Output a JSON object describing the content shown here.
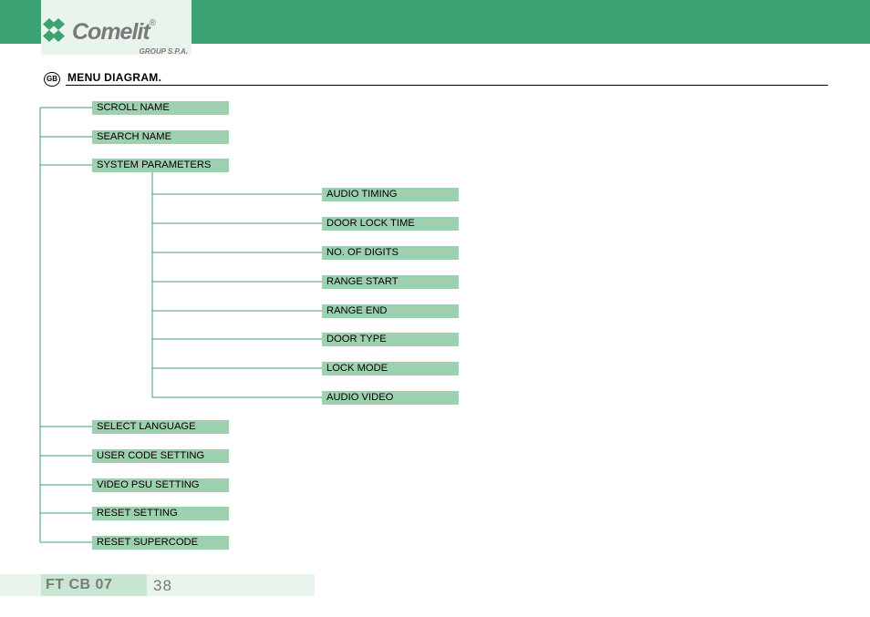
{
  "header": {
    "brand_name": "Comelit",
    "brand_sub": "GROUP S.P.A.",
    "reg_mark": "®"
  },
  "title": {
    "lang_badge": "GB",
    "text": "MENU DIAGRAM."
  },
  "menu": {
    "level1": [
      {
        "label": "SCROLL NAME"
      },
      {
        "label": "SEARCH NAME"
      },
      {
        "label": "SYSTEM PARAMETERS"
      },
      {
        "label": "SELECT LANGUAGE"
      },
      {
        "label": "USER CODE SETTING"
      },
      {
        "label": "VIDEO PSU SETTING"
      },
      {
        "label": "RESET SETTING"
      },
      {
        "label": "RESET SUPERCODE"
      }
    ],
    "system_parameters_children": [
      {
        "label": "AUDIO TIMING"
      },
      {
        "label": "DOOR LOCK TIME"
      },
      {
        "label": "NO. OF DIGITS"
      },
      {
        "label": "RANGE START"
      },
      {
        "label": "RANGE END"
      },
      {
        "label": "DOOR TYPE"
      },
      {
        "label": "LOCK MODE"
      },
      {
        "label": "AUDIO VIDEO"
      }
    ]
  },
  "footer": {
    "code": "FT CB 07",
    "page": "38"
  },
  "colors": {
    "brand_green": "#3da271",
    "cell_green": "#9dd0af",
    "pale_green": "#e9f4ec",
    "mid_pale_green": "#c8e6d2",
    "gray_text": "#7a7a7a"
  }
}
